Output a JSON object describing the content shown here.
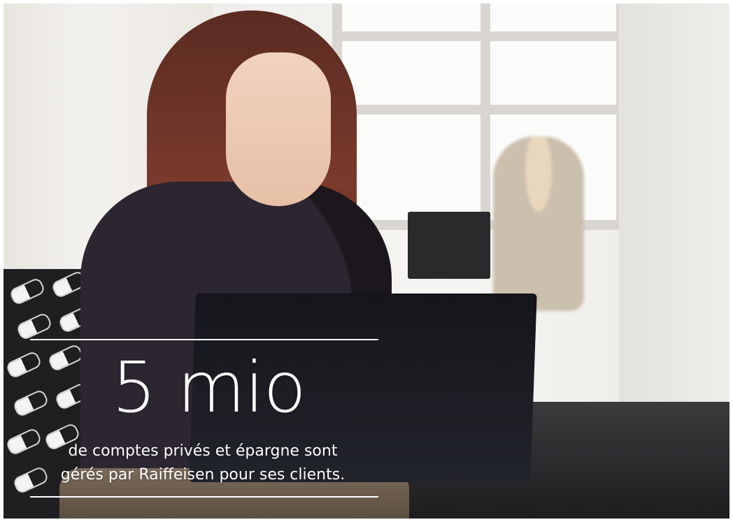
{
  "headline": {
    "figure": "5 mio",
    "caption_line_1": "de comptes privés et épargne sont",
    "caption_line_2": "gérés par Raiffeisen pour ses clients."
  },
  "colors": {
    "text": "#ffffff",
    "rule": "#ffffff"
  }
}
